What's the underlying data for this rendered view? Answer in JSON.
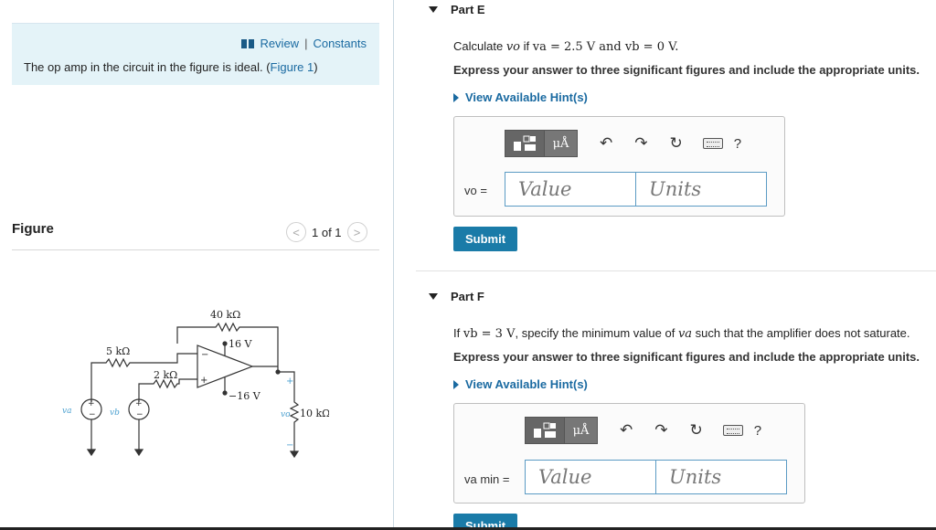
{
  "left": {
    "review_label": "Review",
    "separator": "|",
    "constants_label": "Constants",
    "intro_text": "The op amp in the circuit in the figure is ideal. (",
    "figure_link": "Figure 1",
    "intro_close": ")",
    "figure_title": "Figure",
    "pager": {
      "prev": "<",
      "text": "1 of 1",
      "next": ">"
    }
  },
  "circuit": {
    "r_feedback": "40 kΩ",
    "r_a": "5 kΩ",
    "r_b": "2 kΩ",
    "v_pos": "16 V",
    "v_neg": "−16 V",
    "r_load": "10 kΩ",
    "va": "va",
    "vb": "vb",
    "vo": "vo",
    "plus": "+",
    "minus": "−"
  },
  "partE": {
    "title": "Part E",
    "question_prefix": "Calculate ",
    "question_var": "vo",
    "question_mid": " if ",
    "question_cond": "va = 2.5 V and vb = 0 V.",
    "instruction": "Express your answer to three significant figures and include the appropriate units.",
    "hint": "View Available Hint(s)",
    "var_label": "vo =",
    "value_placeholder": "Value",
    "units_placeholder": "Units",
    "submit": "Submit"
  },
  "partF": {
    "title": "Part F",
    "question_prefix": "If ",
    "question_cond": "vb = 3 V",
    "question_rest": ", specify the minimum value of ",
    "question_var": "va",
    "question_end": " such that the amplifier does not saturate.",
    "instruction": "Express your answer to three significant figures and include the appropriate units.",
    "hint": "View Available Hint(s)",
    "var_label": "va min =",
    "value_placeholder": "Value",
    "units_placeholder": "Units",
    "submit": "Submit"
  },
  "toolbar": {
    "mu_label": "μÅ",
    "undo": "↶",
    "redo": "↷",
    "reset": "↻",
    "help": "?"
  },
  "colors": {
    "accent": "#1a7ba8",
    "link": "#1a6aa1",
    "info_bg": "#e4f3f8"
  }
}
